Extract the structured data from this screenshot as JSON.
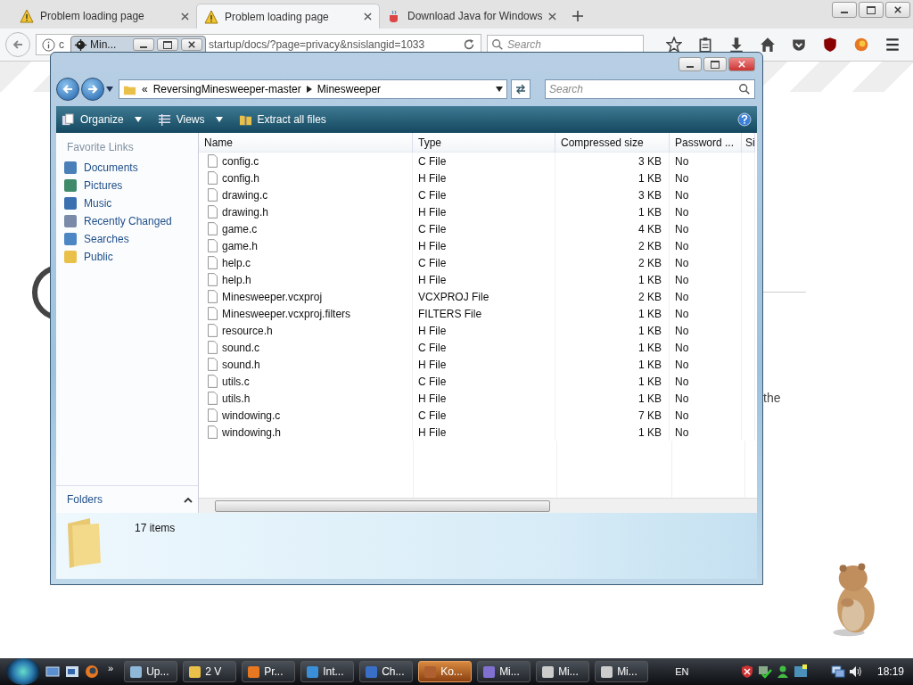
{
  "browser": {
    "tabs": [
      {
        "title": "Problem loading page",
        "kind": "warning",
        "selected": false
      },
      {
        "title": "Problem loading page",
        "kind": "warning",
        "selected": true
      },
      {
        "title": "Download Java for Windows",
        "kind": "java",
        "selected": false
      }
    ],
    "url_start": "c",
    "url_rest": "startup/docs/?page=privacy&nsislangid=1033",
    "search": {
      "placeholder": "Search"
    },
    "page_text": "the"
  },
  "mini_window": {
    "title": "Min..."
  },
  "explorer": {
    "path": [
      "ReversingMinesweeper-master",
      "Minesweeper"
    ],
    "path_prefix": "«",
    "search": {
      "placeholder": "Search"
    },
    "toolbar": [
      "Organize",
      "Views",
      "Extract all files"
    ],
    "favorites_title": "Favorite Links",
    "favorites": [
      {
        "label": "Documents",
        "kind": "documents"
      },
      {
        "label": "Pictures",
        "kind": "pictures"
      },
      {
        "label": "Music",
        "kind": "music"
      },
      {
        "label": "Recently Changed",
        "kind": "recent"
      },
      {
        "label": "Searches",
        "kind": "searches"
      },
      {
        "label": "Public",
        "kind": "folder"
      }
    ],
    "columns": [
      "Name",
      "Type",
      "Compressed size",
      "Password ...",
      "Si"
    ],
    "rows": [
      [
        "config.c",
        "C File",
        "3 KB",
        "No"
      ],
      [
        "config.h",
        "H File",
        "1 KB",
        "No"
      ],
      [
        "drawing.c",
        "C File",
        "3 KB",
        "No"
      ],
      [
        "drawing.h",
        "H File",
        "1 KB",
        "No"
      ],
      [
        "game.c",
        "C File",
        "4 KB",
        "No"
      ],
      [
        "game.h",
        "H File",
        "2 KB",
        "No"
      ],
      [
        "help.c",
        "C File",
        "2 KB",
        "No"
      ],
      [
        "help.h",
        "H File",
        "1 KB",
        "No"
      ],
      [
        "Minesweeper.vcxproj",
        "VCXPROJ File",
        "2 KB",
        "No"
      ],
      [
        "Minesweeper.vcxproj.filters",
        "FILTERS File",
        "1 KB",
        "No"
      ],
      [
        "resource.h",
        "H File",
        "1 KB",
        "No"
      ],
      [
        "sound.c",
        "C File",
        "1 KB",
        "No"
      ],
      [
        "sound.h",
        "H File",
        "1 KB",
        "No"
      ],
      [
        "utils.c",
        "C File",
        "1 KB",
        "No"
      ],
      [
        "utils.h",
        "H File",
        "1 KB",
        "No"
      ],
      [
        "windowing.c",
        "C File",
        "7 KB",
        "No"
      ],
      [
        "windowing.h",
        "H File",
        "1 KB",
        "No"
      ]
    ],
    "folders_label": "Folders",
    "status": "17 items"
  },
  "taskbar": {
    "overflow": "»",
    "buttons": [
      {
        "label": "Up...",
        "kind": "window",
        "selected": false
      },
      {
        "label": "2 V",
        "kind": "folder",
        "selected": false
      },
      {
        "label": "Pr...",
        "kind": "firefox",
        "selected": false
      },
      {
        "label": "Int...",
        "kind": "ie",
        "selected": false
      },
      {
        "label": "Ch...",
        "kind": "monitor",
        "selected": false
      },
      {
        "label": "Ko...",
        "kind": "app",
        "selected": true
      },
      {
        "label": "Mi...",
        "kind": "star",
        "selected": false
      },
      {
        "label": "Mi...",
        "kind": "mine",
        "selected": false
      },
      {
        "label": "Mi...",
        "kind": "mine",
        "selected": false
      }
    ],
    "language": "EN",
    "clock": "18:19"
  }
}
